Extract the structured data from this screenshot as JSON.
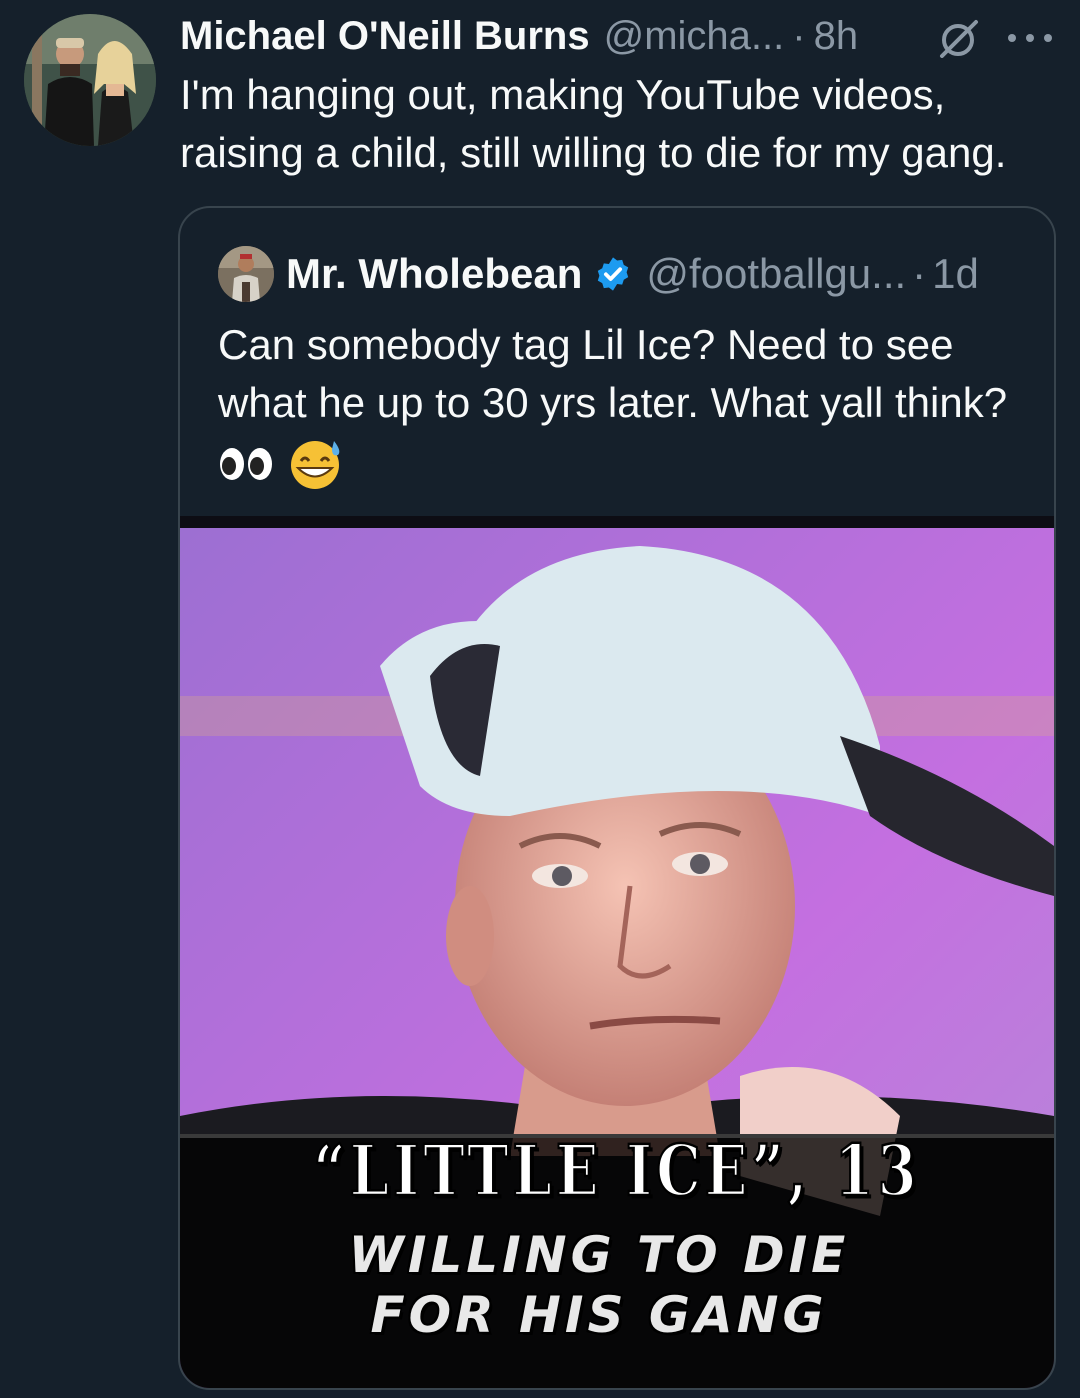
{
  "tweet": {
    "name": "Michael O'Neill Burns",
    "handle": "@micha...",
    "separator": "·",
    "time": "8h",
    "text": "I'm hanging out, making YouTube videos, raising a child, still willing to die for my gang.",
    "icons": [
      "avatar",
      "mute-icon",
      "more-icon"
    ]
  },
  "quote": {
    "name": "Mr. Wholebean",
    "verified": true,
    "handle": "@footballgu...",
    "separator": "·",
    "time": "1d",
    "text": "Can somebody tag Lil Ice? Need to see what he up to 30 yrs later. What yall think?",
    "emojis": [
      "eyes-emoji",
      "grinning-sweat-emoji"
    ],
    "media": {
      "caption_line1": "“LITTLE  ICE”, 13",
      "caption_line2": "WILLING  TO  DIE",
      "caption_line3": "FOR  HIS  GANG"
    }
  },
  "colors": {
    "background": "#15202b",
    "text": "#f7f9f9",
    "secondary": "#8b98a5",
    "border": "#38444d",
    "verified": "#1d9bf0"
  }
}
